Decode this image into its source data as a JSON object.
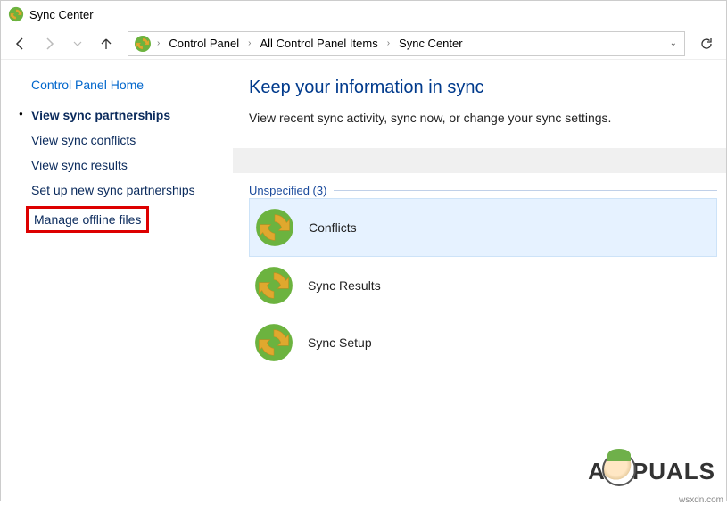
{
  "window": {
    "title": "Sync Center"
  },
  "breadcrumbs": {
    "b0": "Control Panel",
    "b1": "All Control Panel Items",
    "b2": "Sync Center"
  },
  "sidebar": {
    "home": "Control Panel Home",
    "items": {
      "i0": "View sync partnerships",
      "i1": "View sync conflicts",
      "i2": "View sync results",
      "i3": "Set up new sync partnerships",
      "i4": "Manage offline files"
    }
  },
  "main": {
    "heading": "Keep your information in sync",
    "subheading": "View recent sync activity, sync now, or change your sync settings.",
    "group_label": "Unspecified (3)",
    "items": {
      "r0": "Conflicts",
      "r1": "Sync Results",
      "r2": "Sync Setup"
    }
  },
  "watermark": {
    "pre": "A",
    "post": "PUALS"
  },
  "footer": {
    "note": "wsxdn.com"
  }
}
